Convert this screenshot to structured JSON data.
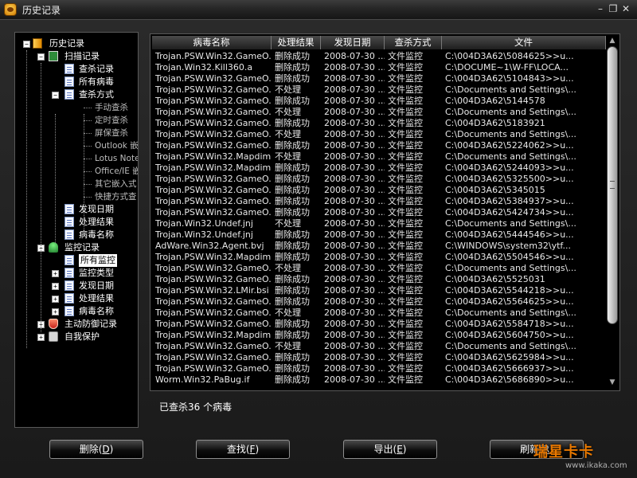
{
  "window": {
    "title": "历史记录",
    "min": "–",
    "max": "❐",
    "close": "✕"
  },
  "tree": [
    {
      "label": "历史记录",
      "level": 0,
      "expander": "−",
      "icon": "book",
      "sel": false
    },
    {
      "label": "扫描记录",
      "level": 1,
      "expander": "−",
      "icon": "scan",
      "sel": false
    },
    {
      "label": "查杀记录",
      "level": 2,
      "expander": "",
      "icon": "doc",
      "sel": false
    },
    {
      "label": "所有病毒",
      "level": 2,
      "expander": "",
      "icon": "doc",
      "sel": false
    },
    {
      "label": "查杀方式",
      "level": 2,
      "expander": "−",
      "icon": "doc",
      "sel": false
    },
    {
      "label": "手动查杀",
      "level": 3,
      "expander": "",
      "icon": "",
      "sel": false
    },
    {
      "label": "定时查杀",
      "level": 3,
      "expander": "",
      "icon": "",
      "sel": false
    },
    {
      "label": "屏保查杀",
      "level": 3,
      "expander": "",
      "icon": "",
      "sel": false
    },
    {
      "label": "Outlook 嵌",
      "level": 3,
      "expander": "",
      "icon": "",
      "sel": false
    },
    {
      "label": "Lotus Note",
      "level": 3,
      "expander": "",
      "icon": "",
      "sel": false
    },
    {
      "label": "Office/IE 嵌",
      "level": 3,
      "expander": "",
      "icon": "",
      "sel": false
    },
    {
      "label": "其它嵌入式",
      "level": 3,
      "expander": "",
      "icon": "",
      "sel": false
    },
    {
      "label": "快捷方式查",
      "level": 3,
      "expander": "",
      "icon": "",
      "sel": false
    },
    {
      "label": "发现日期",
      "level": 2,
      "expander": "",
      "icon": "doc",
      "sel": false
    },
    {
      "label": "处理结果",
      "level": 2,
      "expander": "",
      "icon": "doc",
      "sel": false
    },
    {
      "label": "病毒名称",
      "level": 2,
      "expander": "",
      "icon": "doc",
      "sel": false
    },
    {
      "label": "监控记录",
      "level": 1,
      "expander": "−",
      "icon": "mon",
      "sel": false
    },
    {
      "label": "所有监控",
      "level": 2,
      "expander": "",
      "icon": "doc",
      "sel": true
    },
    {
      "label": "监控类型",
      "level": 2,
      "expander": "+",
      "icon": "doc",
      "sel": false
    },
    {
      "label": "发现日期",
      "level": 2,
      "expander": "+",
      "icon": "doc",
      "sel": false
    },
    {
      "label": "处理结果",
      "level": 2,
      "expander": "+",
      "icon": "doc",
      "sel": false
    },
    {
      "label": "病毒名称",
      "level": 2,
      "expander": "+",
      "icon": "doc",
      "sel": false
    },
    {
      "label": "主动防御记录",
      "level": 1,
      "expander": "+",
      "icon": "shield",
      "sel": false
    },
    {
      "label": "自我保护",
      "level": 1,
      "expander": "+",
      "icon": "lock",
      "sel": false
    }
  ],
  "table": {
    "columns": [
      "病毒名称",
      "处理结果",
      "发现日期",
      "查杀方式",
      "文件"
    ],
    "rows": [
      [
        "Trojan.PSW.Win32.GameO...",
        "删除成功",
        "2008-07-30 ...",
        "文件监控",
        "C:\\004D3A62\\5084625>>u..."
      ],
      [
        "Trojan.Win32.Kill360.a",
        "删除成功",
        "2008-07-30 ...",
        "文件监控",
        "C:\\DOCUME~1\\W-FF\\LOCA..."
      ],
      [
        "Trojan.PSW.Win32.GameO...",
        "删除成功",
        "2008-07-30 ...",
        "文件监控",
        "C:\\004D3A62\\5104843>>u..."
      ],
      [
        "Trojan.PSW.Win32.GameO...",
        "不处理",
        "2008-07-30 ...",
        "文件监控",
        "C:\\Documents and Settings\\..."
      ],
      [
        "Trojan.PSW.Win32.GameO...",
        "删除成功",
        "2008-07-30 ...",
        "文件监控",
        "C:\\004D3A62\\5144578"
      ],
      [
        "Trojan.PSW.Win32.GameO...",
        "不处理",
        "2008-07-30 ...",
        "文件监控",
        "C:\\Documents and Settings\\..."
      ],
      [
        "Trojan.PSW.Win32.GameO...",
        "删除成功",
        "2008-07-30 ...",
        "文件监控",
        "C:\\004D3A62\\5183921"
      ],
      [
        "Trojan.PSW.Win32.GameO...",
        "不处理",
        "2008-07-30 ...",
        "文件监控",
        "C:\\Documents and Settings\\..."
      ],
      [
        "Trojan.PSW.Win32.GameO...",
        "删除成功",
        "2008-07-30 ...",
        "文件监控",
        "C:\\004D3A62\\5224062>>u..."
      ],
      [
        "Trojan.PSW.Win32.Mapdim...",
        "不处理",
        "2008-07-30 ...",
        "文件监控",
        "C:\\Documents and Settings\\..."
      ],
      [
        "Trojan.PSW.Win32.Mapdim...",
        "删除成功",
        "2008-07-30 ...",
        "文件监控",
        "C:\\004D3A62\\5244093>>u..."
      ],
      [
        "Trojan.PSW.Win32.GameO...",
        "删除成功",
        "2008-07-30 ...",
        "文件监控",
        "C:\\004D3A62\\5325500>>u..."
      ],
      [
        "Trojan.PSW.Win32.GameO...",
        "删除成功",
        "2008-07-30 ...",
        "文件监控",
        "C:\\004D3A62\\5345015"
      ],
      [
        "Trojan.PSW.Win32.GameO...",
        "删除成功",
        "2008-07-30 ...",
        "文件监控",
        "C:\\004D3A62\\5384937>>u..."
      ],
      [
        "Trojan.PSW.Win32.GameO...",
        "删除成功",
        "2008-07-30 ...",
        "文件监控",
        "C:\\004D3A62\\5424734>>u..."
      ],
      [
        "Trojan.Win32.Undef.jnj",
        "不处理",
        "2008-07-30 ...",
        "文件监控",
        "C:\\Documents and Settings\\..."
      ],
      [
        "Trojan.Win32.Undef.jnj",
        "删除成功",
        "2008-07-30 ...",
        "文件监控",
        "C:\\004D3A62\\5444546>>u..."
      ],
      [
        "AdWare.Win32.Agent.bvj",
        "删除成功",
        "2008-07-30 ...",
        "文件监控",
        "C:\\WINDOWS\\system32\\ytf..."
      ],
      [
        "Trojan.PSW.Win32.Mapdim...",
        "删除成功",
        "2008-07-30 ...",
        "文件监控",
        "C:\\004D3A62\\5504546>>u..."
      ],
      [
        "Trojan.PSW.Win32.GameO...",
        "不处理",
        "2008-07-30 ...",
        "文件监控",
        "C:\\Documents and Settings\\..."
      ],
      [
        "Trojan.PSW.Win32.GameO...",
        "删除成功",
        "2008-07-30 ...",
        "文件监控",
        "C:\\004D3A62\\5525031"
      ],
      [
        "Trojan.PSW.Win32.LMir.bsi",
        "删除成功",
        "2008-07-30 ...",
        "文件监控",
        "C:\\004D3A62\\5544218>>u..."
      ],
      [
        "Trojan.PSW.Win32.GameO...",
        "删除成功",
        "2008-07-30 ...",
        "文件监控",
        "C:\\004D3A62\\5564625>>u..."
      ],
      [
        "Trojan.PSW.Win32.GameO...",
        "不处理",
        "2008-07-30 ...",
        "文件监控",
        "C:\\Documents and Settings\\..."
      ],
      [
        "Trojan.PSW.Win32.GameO...",
        "删除成功",
        "2008-07-30 ...",
        "文件监控",
        "C:\\004D3A62\\5584718>>u..."
      ],
      [
        "Trojan.PSW.Win32.Mapdim...",
        "删除成功",
        "2008-07-30 ...",
        "文件监控",
        "C:\\004D3A62\\5604750>>u..."
      ],
      [
        "Trojan.PSW.Win32.GameO...",
        "不处理",
        "2008-07-30 ...",
        "文件监控",
        "C:\\Documents and Settings\\..."
      ],
      [
        "Trojan.PSW.Win32.GameO...",
        "删除成功",
        "2008-07-30 ...",
        "文件监控",
        "C:\\004D3A62\\5625984>>u..."
      ],
      [
        "Trojan.PSW.Win32.GameO...",
        "删除成功",
        "2008-07-30 ...",
        "文件监控",
        "C:\\004D3A62\\5666937>>u..."
      ],
      [
        "Worm.Win32.PaBug.if",
        "删除成功",
        "2008-07-30 ...",
        "文件监控",
        "C:\\004D3A62\\5686890>>u..."
      ]
    ]
  },
  "status": "已查杀36 个病毒",
  "buttons": {
    "delete": {
      "label": "删除(",
      "key": "D",
      "end": ")"
    },
    "find": {
      "label": "查找(",
      "key": "F",
      "end": ")"
    },
    "export": {
      "label": "导出(",
      "key": "E",
      "end": ")"
    },
    "refresh": {
      "label": "刷新(",
      "key": "R",
      "end": ")"
    }
  },
  "watermark": {
    "logo": "瑞星卡卡",
    "url": "www.ikaka.com"
  },
  "scroll": {
    "up": "▲",
    "down": "▼"
  }
}
